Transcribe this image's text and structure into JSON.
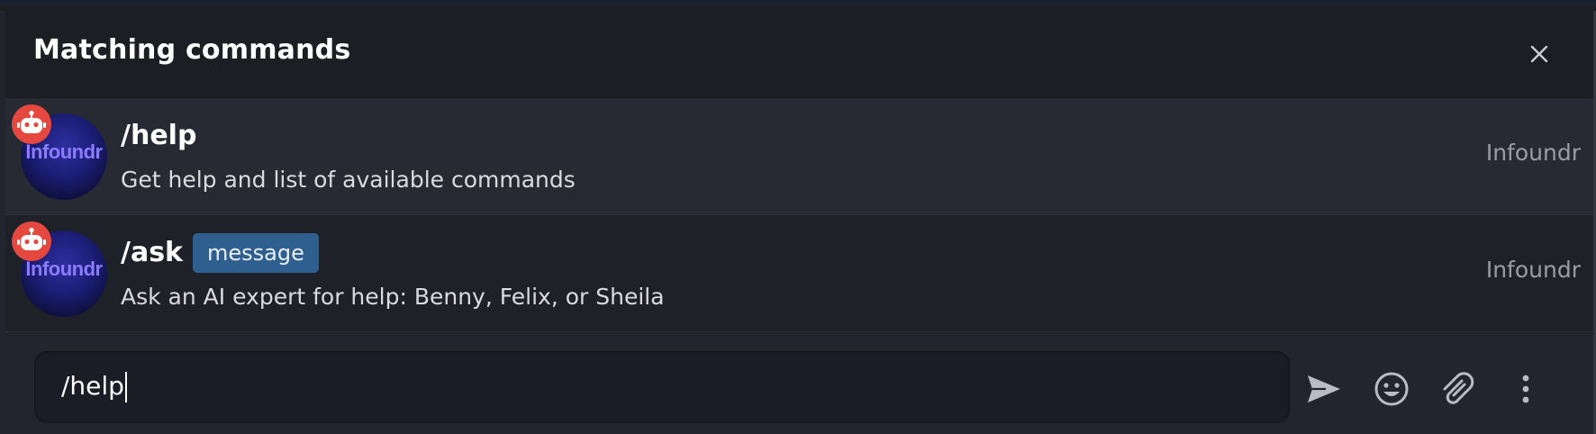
{
  "panel": {
    "title": "Matching commands",
    "close_icon": "close-icon"
  },
  "commands": [
    {
      "name": "/help",
      "description": "Get help and list of available commands",
      "source": "Infoundr",
      "avatar_text": "Infoundr",
      "selected": true
    },
    {
      "name": "/ask",
      "argument": "message",
      "description": "Ask an AI expert for help: Benny, Felix, or Sheila",
      "source": "Infoundr",
      "avatar_text": "Infoundr",
      "selected": false
    }
  ],
  "composer": {
    "input_value": "/help",
    "actions": [
      "send-icon",
      "emoji-icon",
      "attach-icon",
      "more-vertical-icon"
    ]
  },
  "colors": {
    "background": "#1c1e24",
    "selected_row": "#272a33",
    "argument_badge": "#2f5f8e",
    "bot_badge": "#e5483f",
    "avatar_text": "#8d7bff"
  }
}
